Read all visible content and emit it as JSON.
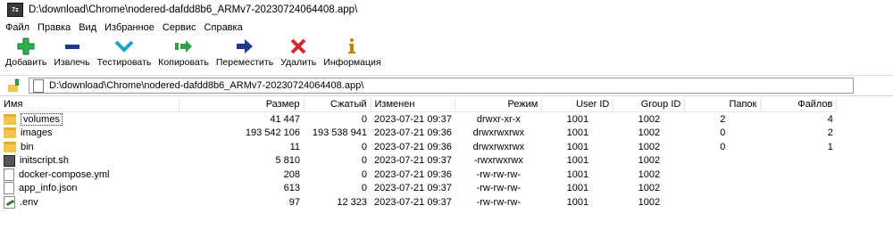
{
  "window": {
    "icon_text": "7z",
    "title": "D:\\download\\Chrome\\nodered-dafdd8b6_ARMv7-20230724064408.app\\"
  },
  "menu": [
    "Файл",
    "Правка",
    "Вид",
    "Избранное",
    "Сервис",
    "Справка"
  ],
  "toolbar": [
    {
      "label": "Добавить",
      "icon": "plus-icon",
      "color": "#2bb24c"
    },
    {
      "label": "Извлечь",
      "icon": "minus-icon",
      "color": "#1e3a8a"
    },
    {
      "label": "Тестировать",
      "icon": "check-chevron-icon",
      "color": "#1aa7c9"
    },
    {
      "label": "Копировать",
      "icon": "copy-arrow-icon",
      "color": "#2f9e44"
    },
    {
      "label": "Переместить",
      "icon": "arrow-right-icon",
      "color": "#1e3a8a"
    },
    {
      "label": "Удалить",
      "icon": "x-icon",
      "color": "#d62828"
    },
    {
      "label": "Информация",
      "icon": "info-icon",
      "color": "#b8860b"
    }
  ],
  "address": {
    "path": "D:\\download\\Chrome\\nodered-dafdd8b6_ARMv7-20230724064408.app\\"
  },
  "columns": {
    "name": "Имя",
    "size": "Размер",
    "packed": "Сжатый",
    "modified": "Изменен",
    "mode": "Режим",
    "user": "User ID",
    "group": "Group ID",
    "folders": "Папок",
    "files": "Файлов"
  },
  "rows": [
    {
      "type": "folder",
      "name": "volumes",
      "size": "41 447",
      "packed": "0",
      "modified": "2023-07-21 09:37",
      "mode": "drwxr-xr-x",
      "user": "1001",
      "group": "1002",
      "folders": "2",
      "files": "4"
    },
    {
      "type": "folder",
      "name": "images",
      "size": "193 542 106",
      "packed": "193 538 941",
      "modified": "2023-07-21 09:36",
      "mode": "drwxrwxrwx",
      "user": "1001",
      "group": "1002",
      "folders": "0",
      "files": "2"
    },
    {
      "type": "folder",
      "name": "bin",
      "size": "11",
      "packed": "0",
      "modified": "2023-07-21 09:36",
      "mode": "drwxrwxrwx",
      "user": "1001",
      "group": "1002",
      "folders": "0",
      "files": "1"
    },
    {
      "type": "sh",
      "name": "initscript.sh",
      "size": "5 810",
      "packed": "0",
      "modified": "2023-07-21 09:37",
      "mode": "-rwxrwxrwx",
      "user": "1001",
      "group": "1002",
      "folders": "",
      "files": ""
    },
    {
      "type": "yml",
      "name": "docker-compose.yml",
      "size": "208",
      "packed": "0",
      "modified": "2023-07-21 09:36",
      "mode": "-rw-rw-rw-",
      "user": "1001",
      "group": "1002",
      "folders": "",
      "files": ""
    },
    {
      "type": "json",
      "name": "app_info.json",
      "size": "613",
      "packed": "0",
      "modified": "2023-07-21 09:37",
      "mode": "-rw-rw-rw-",
      "user": "1001",
      "group": "1002",
      "folders": "",
      "files": ""
    },
    {
      "type": "env",
      "name": ".env",
      "size": "97",
      "packed": "12 323",
      "modified": "2023-07-21 09:37",
      "mode": "-rw-rw-rw-",
      "user": "1001",
      "group": "1002",
      "folders": "",
      "files": ""
    }
  ]
}
